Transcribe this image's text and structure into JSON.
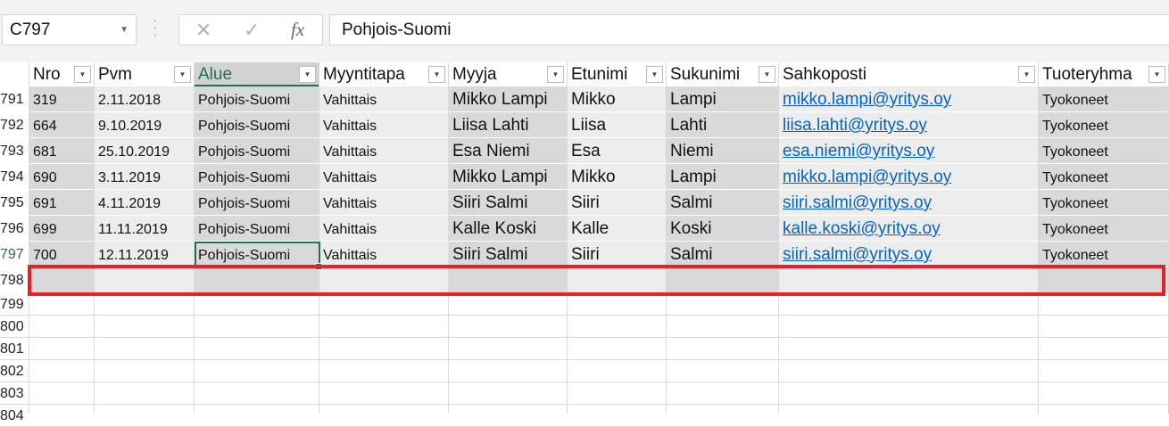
{
  "formula_bar": {
    "name_box": "C797",
    "cancel_icon": "✕",
    "enter_icon": "✓",
    "fx_label": "fx",
    "formula_value": "Pohjois-Suomi"
  },
  "columns": [
    {
      "key": "nro",
      "label": "Nro"
    },
    {
      "key": "pvm",
      "label": "Pvm"
    },
    {
      "key": "alue",
      "label": "Alue"
    },
    {
      "key": "myyntitapa",
      "label": "Myyntitapa"
    },
    {
      "key": "myyja",
      "label": "Myyja"
    },
    {
      "key": "etunimi",
      "label": "Etunimi"
    },
    {
      "key": "sukunimi",
      "label": "Sukunimi"
    },
    {
      "key": "sahkoposti",
      "label": "Sahkoposti"
    },
    {
      "key": "tuoteryhma",
      "label": "Tuoteryhma"
    }
  ],
  "header_row_number": "",
  "rows": [
    {
      "row": "791",
      "nro": "319",
      "pvm": "2.11.2018",
      "alue": "Pohjois-Suomi",
      "myyntitapa": "Vahittais",
      "myyja": "Mikko Lampi",
      "etunimi": "Mikko",
      "sukunimi": "Lampi",
      "sahkoposti": "mikko.lampi@yritys.oy",
      "tuoteryhma": "Tyokoneet"
    },
    {
      "row": "792",
      "nro": "664",
      "pvm": "9.10.2019",
      "alue": "Pohjois-Suomi",
      "myyntitapa": "Vahittais",
      "myyja": "Liisa Lahti",
      "etunimi": "Liisa",
      "sukunimi": "Lahti",
      "sahkoposti": "liisa.lahti@yritys.oy",
      "tuoteryhma": "Tyokoneet"
    },
    {
      "row": "793",
      "nro": "681",
      "pvm": "25.10.2019",
      "alue": "Pohjois-Suomi",
      "myyntitapa": "Vahittais",
      "myyja": "Esa Niemi",
      "etunimi": "Esa",
      "sukunimi": "Niemi",
      "sahkoposti": "esa.niemi@yritys.oy",
      "tuoteryhma": "Tyokoneet"
    },
    {
      "row": "794",
      "nro": "690",
      "pvm": "3.11.2019",
      "alue": "Pohjois-Suomi",
      "myyntitapa": "Vahittais",
      "myyja": "Mikko Lampi",
      "etunimi": "Mikko",
      "sukunimi": "Lampi",
      "sahkoposti": "mikko.lampi@yritys.oy",
      "tuoteryhma": "Tyokoneet"
    },
    {
      "row": "795",
      "nro": "691",
      "pvm": "4.11.2019",
      "alue": "Pohjois-Suomi",
      "myyntitapa": "Vahittais",
      "myyja": "Siiri Salmi",
      "etunimi": "Siiri",
      "sukunimi": "Salmi",
      "sahkoposti": "siiri.salmi@yritys.oy",
      "tuoteryhma": "Tyokoneet"
    },
    {
      "row": "796",
      "nro": "699",
      "pvm": "11.11.2019",
      "alue": "Pohjois-Suomi",
      "myyntitapa": "Vahittais",
      "myyja": "Kalle Koski",
      "etunimi": "Kalle",
      "sukunimi": "Koski",
      "sahkoposti": "kalle.koski@yritys.oy",
      "tuoteryhma": "Tyokoneet"
    },
    {
      "row": "797",
      "nro": "700",
      "pvm": "12.11.2019",
      "alue": "Pohjois-Suomi",
      "myyntitapa": "Vahittais",
      "myyja": "Siiri Salmi",
      "etunimi": "Siiri",
      "sukunimi": "Salmi",
      "sahkoposti": "siiri.salmi@yritys.oy",
      "tuoteryhma": "Tyokoneet"
    }
  ],
  "empty_table_row": "798",
  "empty_rows": [
    "799",
    "800",
    "801",
    "802",
    "803",
    "804"
  ],
  "colors": {
    "accent_green": "#217346",
    "highlight_red": "#e8202a",
    "link_blue": "#0563c1",
    "band_dark": "#d9d9d9",
    "band_light": "#ededed"
  }
}
